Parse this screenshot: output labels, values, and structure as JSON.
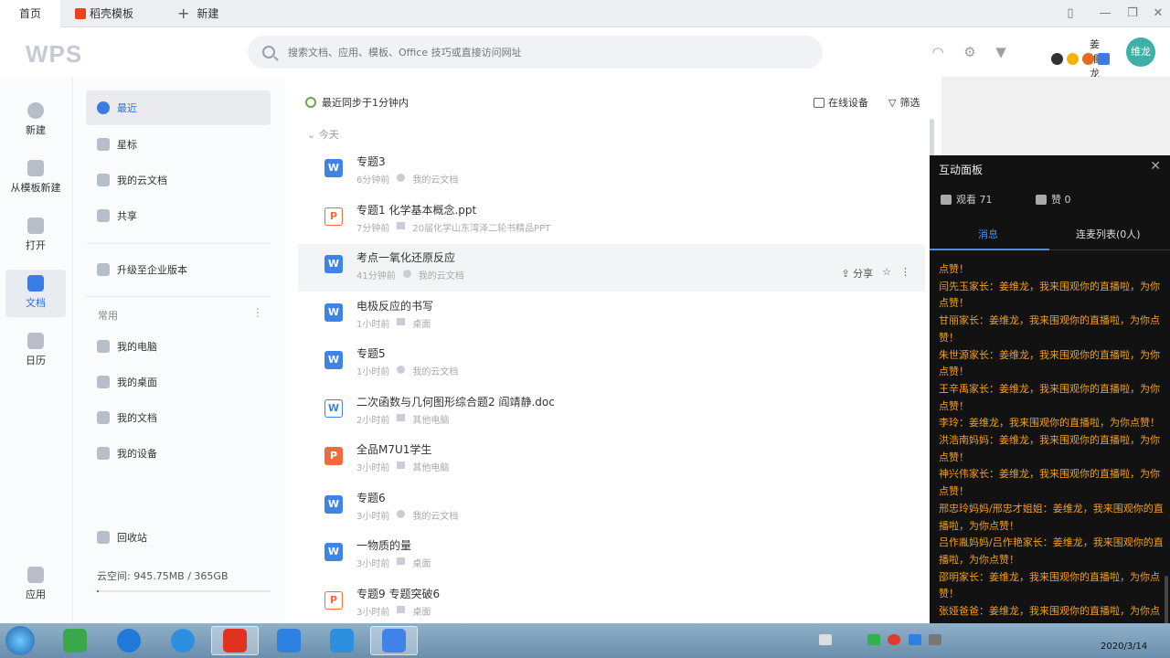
{
  "tabs": {
    "home": "首页",
    "template": "稻壳模板",
    "new_tab": "新建"
  },
  "header": {
    "logo": "WPS",
    "search_placeholder": "搜索文档、应用、模板、Office 技巧或直接访问网址",
    "username": "姜维龙",
    "avatar_text": "维龙"
  },
  "rail": [
    {
      "label": "新建"
    },
    {
      "label": "从模板新建"
    },
    {
      "label": "打开"
    },
    {
      "label": "文档"
    },
    {
      "label": "日历"
    },
    {
      "label": "应用"
    }
  ],
  "sidebar": {
    "items": [
      {
        "label": "最近"
      },
      {
        "label": "星标"
      },
      {
        "label": "我的云文档"
      },
      {
        "label": "共享"
      }
    ],
    "upgrade": "升级至企业版本",
    "section_common": "常用",
    "common_items": [
      {
        "label": "我的电脑"
      },
      {
        "label": "我的桌面"
      },
      {
        "label": "我的文档"
      },
      {
        "label": "我的设备"
      }
    ],
    "recycle": "回收站",
    "storage": "云空间: 945.75MB / 365GB",
    "storage_fraction": 0.003
  },
  "main": {
    "sync": "最近同步于1分钟内",
    "online_devices": "在线设备",
    "filter": "筛选",
    "today": "今天",
    "files": [
      {
        "name": "专题3",
        "time": "6分钟前",
        "location": "我的云文档",
        "type": "w"
      },
      {
        "name": "专题1  化学基本概念.ppt",
        "time": "7分钟前",
        "location": "20届化学山东湾泽二轮书精品PPT",
        "type": "p-outline"
      },
      {
        "name": "考点一氧化还原反应",
        "time": "41分钟前",
        "location": "我的云文档",
        "type": "w"
      },
      {
        "name": "电极反应的书写",
        "time": "1小时前",
        "location": "桌面",
        "type": "w"
      },
      {
        "name": "专题5",
        "time": "1小时前",
        "location": "我的云文档",
        "type": "w"
      },
      {
        "name": "二次函数与几何图形综合题2 阎靖静.doc",
        "time": "2小时前",
        "location": "其他电脑",
        "type": "w-outline"
      },
      {
        "name": "全品M7U1学生",
        "time": "3小时前",
        "location": "其他电脑",
        "type": "p"
      },
      {
        "name": "专题6",
        "time": "3小时前",
        "location": "我的云文档",
        "type": "w"
      },
      {
        "name": "一物质的量",
        "time": "3小时前",
        "location": "桌面",
        "type": "w"
      },
      {
        "name": "专题9 专题突破6",
        "time": "3小时前",
        "location": "桌面",
        "type": "p-outline"
      }
    ],
    "row_share": "分享"
  },
  "panel": {
    "title": "互动面板",
    "viewers": "观看 71",
    "likes": "赞 0",
    "tab_messages": "消息",
    "tab_mic": "连麦列表(0人)",
    "messages": [
      "点赞！",
      "闫先玉家长：姜维龙，我来围观你的直播啦，为你点赞！",
      "甘丽家长：姜维龙，我来围观你的直播啦，为你点赞！",
      "朱世源家长：姜维龙，我来围观你的直播啦，为你点赞！",
      "王辛禹家长：姜维龙，我来围观你的直播啦，为你点赞！",
      "李玲：姜维龙，我来围观你的直播啦，为你点赞！",
      "洪浩南妈妈：姜维龙，我来围观你的直播啦，为你点赞！",
      "神兴伟家长：姜维龙，我来围观你的直播啦，为你点赞！",
      "邢忠玲妈妈/邢忠才姐姐：姜维龙，我来围观你的直播啦，为你点赞！",
      "吕作胤妈妈/吕作艳家长：姜维龙，我来围观你的直播啦，为你点赞！",
      "邵明家长：姜维龙，我来围观你的直播啦，为你点赞！",
      "张娅爸爸：姜维龙，我来围观你的直播啦，为你点赞！"
    ]
  },
  "taskbar": {
    "clock": "2020/3/14"
  },
  "colors": {
    "accent": "#3a7be5",
    "message": "#f0a020",
    "panel_bg": "#121212"
  }
}
